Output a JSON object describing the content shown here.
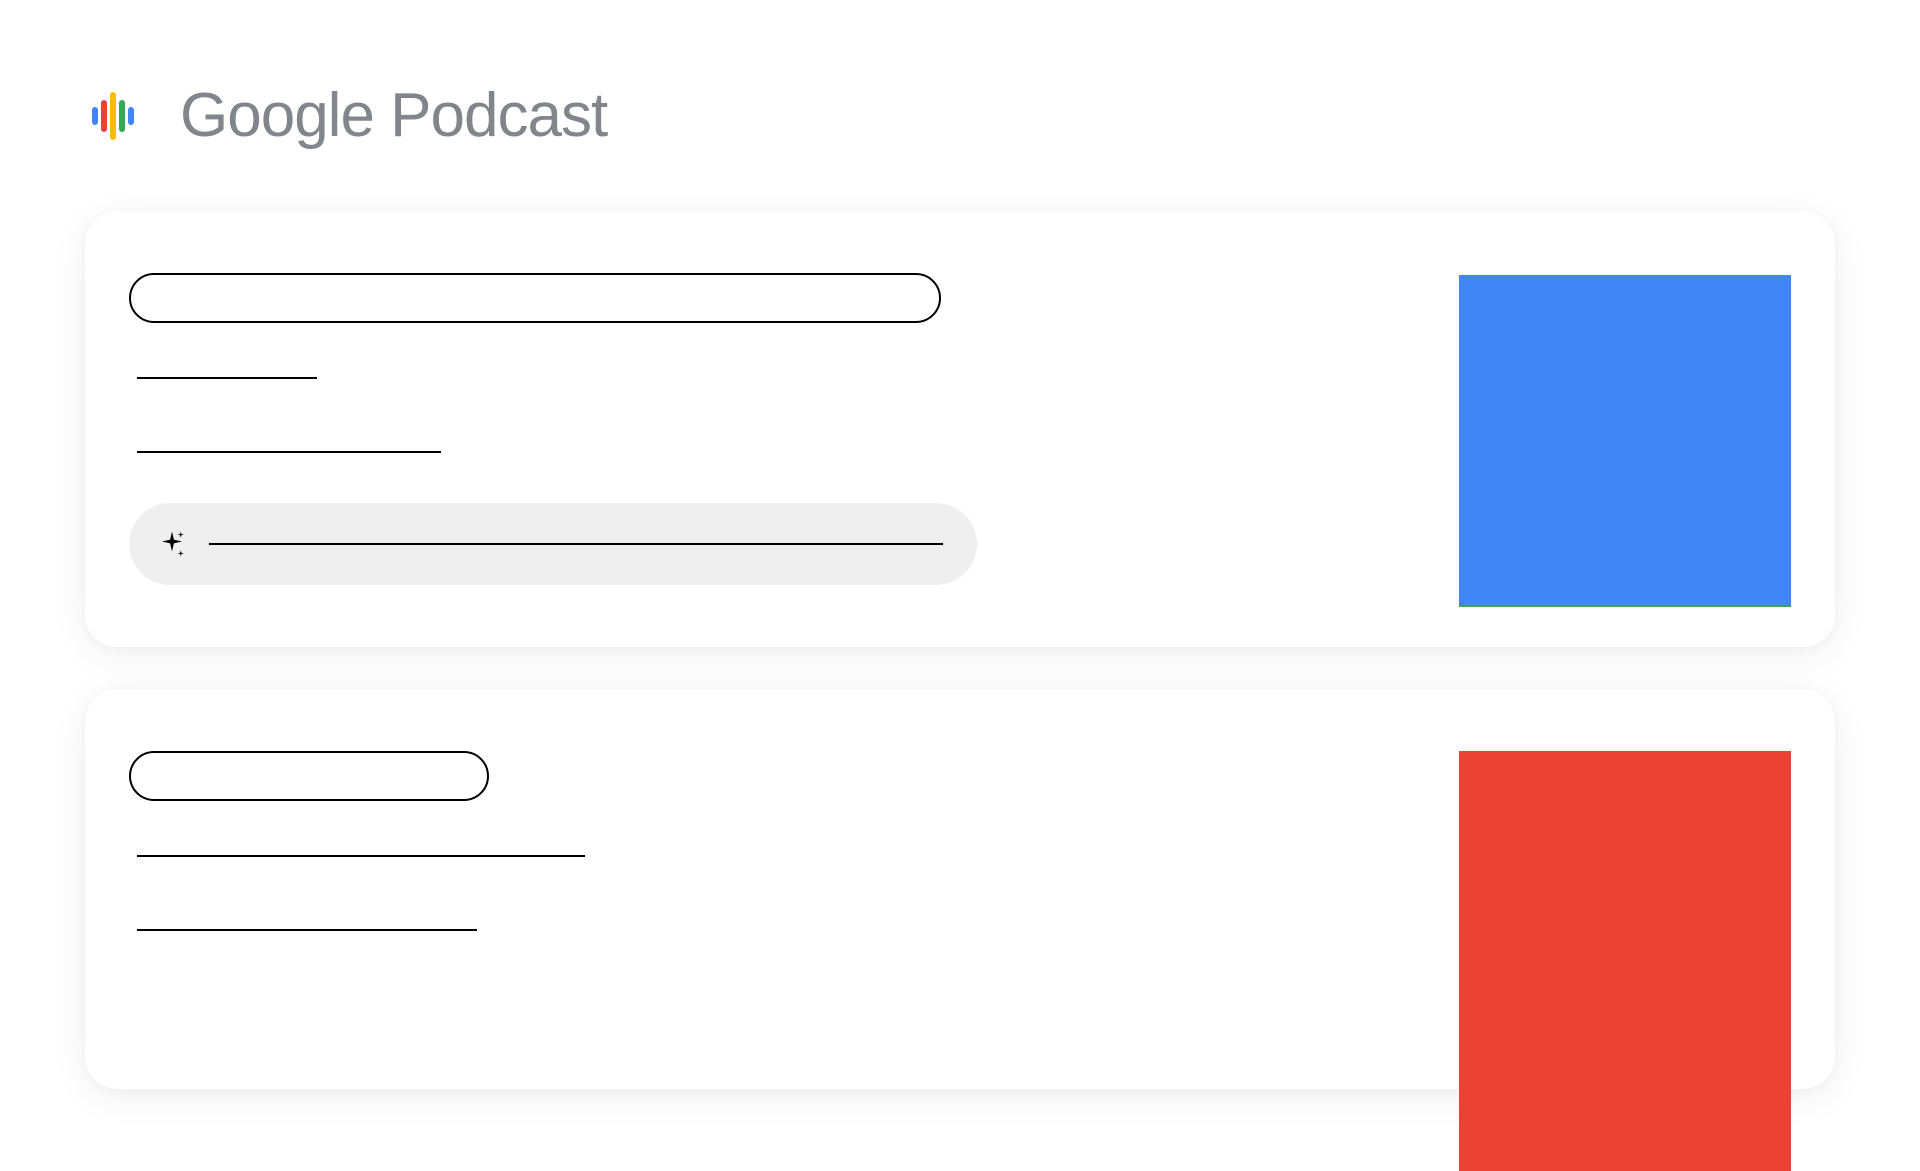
{
  "header": {
    "app_title": "Google Podcast"
  },
  "cards": [
    {
      "thumbnail_color": "#4285F4",
      "has_ai_summary": true
    },
    {
      "thumbnail_color": "#EA4335",
      "has_ai_summary": false
    }
  ]
}
